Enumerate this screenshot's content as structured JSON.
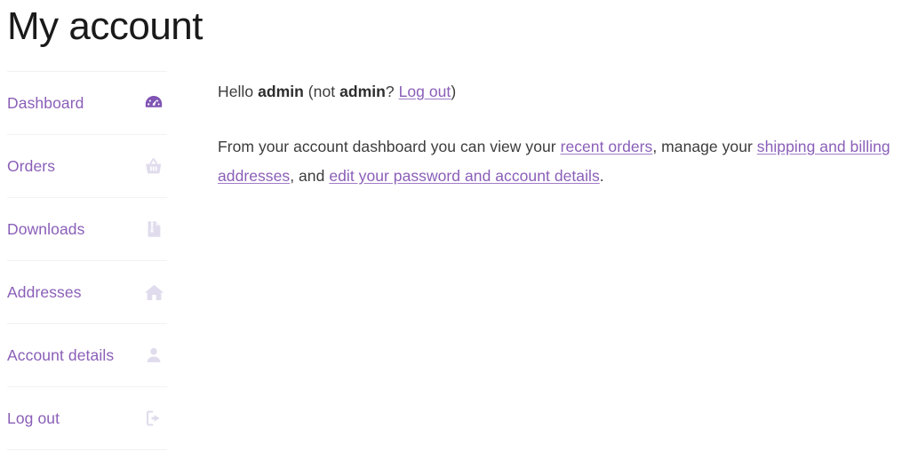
{
  "page": {
    "title": "My account"
  },
  "colors": {
    "accent_purple": "#8a5fb8",
    "icon_active": "#7f54b3",
    "icon_inactive": "#e0dced",
    "text_body": "#3c3c3c",
    "title_text": "#1a1a1a",
    "divider": "#f2f2f4"
  },
  "nav": {
    "items": [
      {
        "label": "Dashboard",
        "icon": "dashboard-gauge-icon",
        "active": true
      },
      {
        "label": "Orders",
        "icon": "shopping-basket-icon",
        "active": false
      },
      {
        "label": "Downloads",
        "icon": "zip-file-icon",
        "active": false
      },
      {
        "label": "Addresses",
        "icon": "home-icon",
        "active": false
      },
      {
        "label": "Account details",
        "icon": "user-icon",
        "active": false
      },
      {
        "label": "Log out",
        "icon": "sign-out-icon",
        "active": false
      }
    ]
  },
  "content": {
    "greeting": {
      "hello": "Hello",
      "username": "admin",
      "not_prefix": "(not",
      "not_username": "admin",
      "question": "?",
      "logout_link": "Log out",
      "close_paren": ")"
    },
    "intro": {
      "part1": "From your account dashboard you can view your",
      "link_orders": "recent orders",
      "part2": ", manage your",
      "link_addresses": "shipping and billing addresses",
      "part3": ", and",
      "link_details": "edit your password and account details",
      "part4": "."
    }
  }
}
